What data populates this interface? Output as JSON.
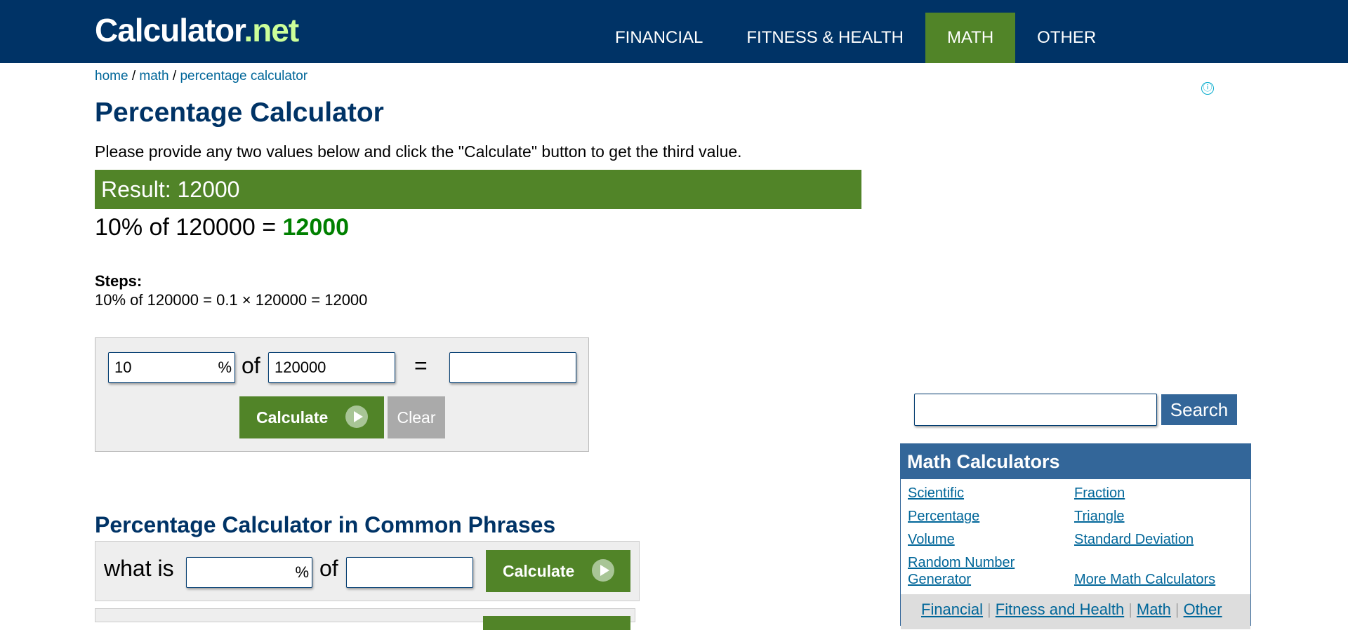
{
  "header": {
    "logo_main": "Calculator",
    "logo_tld": ".net",
    "nav": [
      {
        "label": "FINANCIAL"
      },
      {
        "label": "FITNESS & HEALTH"
      },
      {
        "label": "MATH"
      },
      {
        "label": "OTHER"
      }
    ]
  },
  "breadcrumb": {
    "home": "home",
    "math": "math",
    "current": "percentage calculator",
    "sep": "/"
  },
  "ad_info_icon": "ⓘ",
  "page": {
    "title": "Percentage Calculator",
    "intro": "Please provide any two values below and click the \"Calculate\" button to get the third value."
  },
  "result": {
    "bar": "Result: 12000",
    "equation_prefix": "10% of 120000 = ",
    "answer": "12000",
    "steps_label": "Steps:",
    "steps_text": "10% of 120000 = 0.1 × 120000 = 12000"
  },
  "calculator": {
    "percent_value": "10",
    "percent_symbol": "%",
    "of_label": "of",
    "base_value": "120000",
    "equals": "=",
    "result_value": "",
    "calculate_label": "Calculate",
    "clear_label": "Clear"
  },
  "phrases": {
    "title": "Percentage Calculator in Common Phrases",
    "row1_prefix": "what is",
    "row1_percent_symbol": "%",
    "row1_of": "of",
    "calculate_label": "Calculate"
  },
  "sidebar": {
    "search_value": "",
    "search_label": "Search",
    "box_title": "Math Calculators",
    "links": [
      "Scientific",
      "Fraction",
      "Percentage",
      "Triangle",
      "Volume",
      "Standard Deviation",
      "Random Number Generator",
      "More Math Calculators"
    ],
    "footer": [
      "Financial",
      "Fitness and Health",
      "Math",
      "Other"
    ],
    "footer_sep": "|"
  },
  "colors": {
    "header_bg": "#003366",
    "accent_green": "#518428",
    "answer_green": "#008000",
    "link_blue": "#006699",
    "sidebar_blue": "#336699"
  }
}
